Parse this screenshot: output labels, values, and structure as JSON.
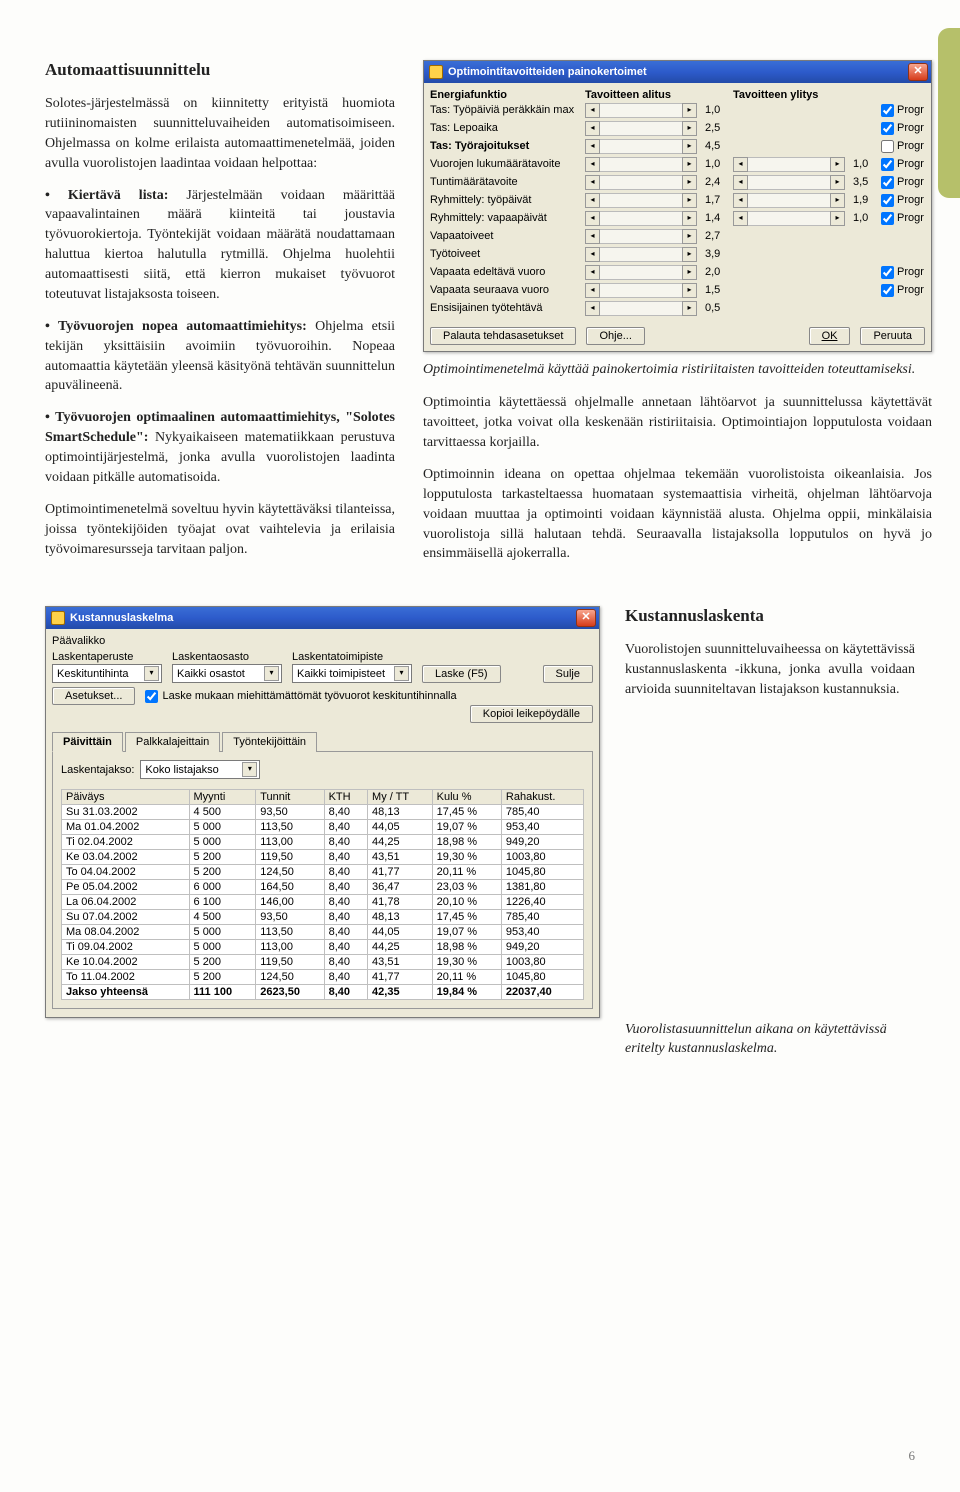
{
  "page_number": "6",
  "article": {
    "title": "Automaattisuunnittelu",
    "intro": "Solotes-järjestelmässä on kiinnitetty erityistä huomiota rutiininomaisten suunnitteluvaiheiden automatisoimiseen. Ohjelmassa on kolme erilaista automaattimenetelmää, joiden avulla vuorolistojen laadintaa voidaan helpottaa:",
    "bullets": [
      {
        "label": "Kiertävä lista:",
        "text": " Järjestelmään voidaan määrittää vapaavalintainen määrä kiinteitä tai joustavia työvuorokiertoja. Työntekijät voidaan määrätä noudattamaan haluttua kiertoa halutulla rytmillä. Ohjelma huolehtii automaattisesti siitä, että kierron mukaiset työvuorot toteutuvat listajaksosta toiseen."
      },
      {
        "label": "Työvuorojen nopea automaattimiehitys:",
        "text": " Ohjelma etsii tekijän yksittäisiin avoimiin työvuoroihin. Nopeaa automaattia käytetään yleensä käsityönä tehtävän suunnittelun apuvälineenä."
      },
      {
        "label": "Työvuorojen optimaalinen automaattimiehitys, \"Solotes SmartSchedule\":",
        "text": " Nykyaikaiseen matematiikkaan perustuva optimointijärjestelmä, jonka avulla vuorolistojen laadinta voidaan pitkälle automatisoida."
      }
    ],
    "after_bullets": "Optimointimenetelmä soveltuu hyvin käytettäväksi tilanteissa, joissa työntekijöiden työajat ovat vaihtelevia ja erilaisia työvoimaresursseja tarvitaan paljon.",
    "caption1": "Optimointimenetelmä käyttää painokertoimia ristiriitaisten tavoitteiden toteuttamiseksi.",
    "right_p1": "Optimointia käytettäessä ohjelmalle annetaan lähtöarvot ja suunnittelussa käytettävät tavoitteet, jotka voivat olla keskenään ristiriitaisia. Optimointiajon lopputulosta voidaan tarvittaessa korjailla.",
    "right_p2": "Optimoinnin ideana on opettaa ohjelmaa tekemään vuorolistoista oikeanlaisia. Jos lopputulosta tarkasteltaessa huomataan systemaattisia virheitä, ohjelman lähtöarvoja voidaan muuttaa ja optimointi voidaan käynnistää alusta. Ohjelma oppii, minkälaisia vuorolistoja sillä halutaan tehdä. Seuraavalla listajaksolla lopputulos on hyvä jo ensimmäisellä ajokerralla."
  },
  "opt_dialog": {
    "title": "Optimointitavoitteiden painokertoimet",
    "h1": "Energiafunktio",
    "h2": "Tavoitteen alitus",
    "h3": "Tavoitteen ylitys",
    "rows": [
      {
        "label": "Tas: Työpäiviä peräkkäin max",
        "bold": false,
        "v1": "1,0",
        "s2": false,
        "chk": true
      },
      {
        "label": "Tas: Lepoaika",
        "bold": false,
        "v1": "2,5",
        "s2": false,
        "chk": true
      },
      {
        "label": "Tas: Työrajoitukset",
        "bold": true,
        "v1": "4,5",
        "s2": false,
        "chk": false
      },
      {
        "label": "Vuorojen lukumäärätavoite",
        "bold": false,
        "v1": "1,0",
        "s2": true,
        "v2": "1,0",
        "chk": true
      },
      {
        "label": "Tuntimäärätavoite",
        "bold": false,
        "v1": "2,4",
        "s2": true,
        "v2": "3,5",
        "chk": true
      },
      {
        "label": "Ryhmittely: työpäivät",
        "bold": false,
        "v1": "1,7",
        "s2": true,
        "v2": "1,9",
        "chk": true
      },
      {
        "label": "Ryhmittely: vapaapäivät",
        "bold": false,
        "v1": "1,4",
        "s2": true,
        "v2": "1,0",
        "chk": true
      },
      {
        "label": "Vapaatoiveet",
        "bold": false,
        "v1": "2,7",
        "s2": false,
        "chk": null
      },
      {
        "label": "Työtoiveet",
        "bold": false,
        "v1": "3,9",
        "s2": false,
        "chk": null
      },
      {
        "label": "Vapaata edeltävä vuoro",
        "bold": false,
        "v1": "2,0",
        "s2": false,
        "chk": true
      },
      {
        "label": "Vapaata seuraava vuoro",
        "bold": false,
        "v1": "1,5",
        "s2": false,
        "chk": true
      },
      {
        "label": "Ensisijainen työtehtävä",
        "bold": false,
        "v1": "0,5",
        "s2": false,
        "chk": null
      }
    ],
    "btn_reset": "Palauta tehdasasetukset",
    "btn_help": "Ohje...",
    "btn_ok": "OK",
    "btn_cancel": "Peruuta",
    "progr_label": "Progr"
  },
  "cost_section": {
    "title": "Kustannuslaskenta",
    "p1": "Vuorolistojen suunnitteluvaiheessa on käytettävissä kustannuslaskenta -ikkuna, jonka avulla voidaan arvioida suunniteltavan listajakson kustannuksia.",
    "caption": "Vuorolistasuunnittelun aikana on käytettävissä eritelty kustannuslaskelma."
  },
  "cost_dialog": {
    "title": "Kustannuslaskelma",
    "menu": "Päävalikko",
    "f1_label": "Laskentaperuste",
    "f1_val": "Keskituntihinta",
    "f2_label": "Laskentaosasto",
    "f2_val": "Kaikki osastot",
    "f3_label": "Laskentatoimipiste",
    "f3_val": "Kaikki toimipisteet",
    "btn_calc": "Laske (F5)",
    "btn_close": "Sulje",
    "btn_settings": "Asetukset...",
    "chk_label": "Laske mukaan miehittämättömät työvuorot keskituntihinnalla",
    "btn_copy": "Kopioi leikepöydälle",
    "tabs": [
      "Päivittäin",
      "Palkkalajeittain",
      "Työntekijöittäin"
    ],
    "calc_period_label": "Laskentajakso:",
    "calc_period_val": "Koko listajakso",
    "table_headers": [
      "Päiväys",
      "Myynti",
      "Tunnit",
      "KTH",
      "My / TT",
      "Kulu %",
      "Rahakust."
    ],
    "table_rows": [
      [
        "Su 31.03.2002",
        "4 500",
        "93,50",
        "8,40",
        "48,13",
        "17,45 %",
        "785,40"
      ],
      [
        "Ma 01.04.2002",
        "5 000",
        "113,50",
        "8,40",
        "44,05",
        "19,07 %",
        "953,40"
      ],
      [
        "Ti 02.04.2002",
        "5 000",
        "113,00",
        "8,40",
        "44,25",
        "18,98 %",
        "949,20"
      ],
      [
        "Ke 03.04.2002",
        "5 200",
        "119,50",
        "8,40",
        "43,51",
        "19,30 %",
        "1003,80"
      ],
      [
        "To 04.04.2002",
        "5 200",
        "124,50",
        "8,40",
        "41,77",
        "20,11 %",
        "1045,80"
      ],
      [
        "Pe 05.04.2002",
        "6 000",
        "164,50",
        "8,40",
        "36,47",
        "23,03 %",
        "1381,80"
      ],
      [
        "La 06.04.2002",
        "6 100",
        "146,00",
        "8,40",
        "41,78",
        "20,10 %",
        "1226,40"
      ],
      [
        "Su 07.04.2002",
        "4 500",
        "93,50",
        "8,40",
        "48,13",
        "17,45 %",
        "785,40"
      ],
      [
        "Ma 08.04.2002",
        "5 000",
        "113,50",
        "8,40",
        "44,05",
        "19,07 %",
        "953,40"
      ],
      [
        "Ti 09.04.2002",
        "5 000",
        "113,00",
        "8,40",
        "44,25",
        "18,98 %",
        "949,20"
      ],
      [
        "Ke 10.04.2002",
        "5 200",
        "119,50",
        "8,40",
        "43,51",
        "19,30 %",
        "1003,80"
      ],
      [
        "To 11.04.2002",
        "5 200",
        "124,50",
        "8,40",
        "41,77",
        "20,11 %",
        "1045,80"
      ]
    ],
    "table_total": [
      "Jakso yhteensä",
      "111 100",
      "2623,50",
      "8,40",
      "42,35",
      "19,84 %",
      "22037,40"
    ]
  }
}
